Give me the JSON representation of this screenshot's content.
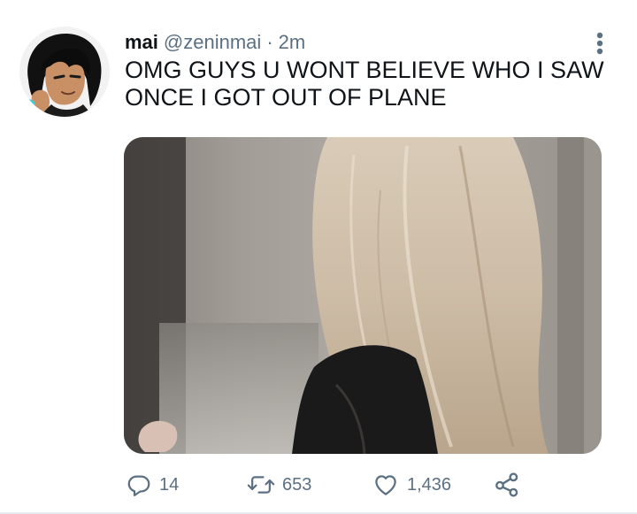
{
  "tweet": {
    "author": {
      "name": "mai",
      "handle": "@zeninmai",
      "separator": "·",
      "time": "2m"
    },
    "text_lines": [
      "OMG GUYS U WONT BELIEVE WHO I SAW",
      "ONCE I GOT OUT OF PLANE"
    ],
    "actions": {
      "replies": "14",
      "retweets": "653",
      "likes": "1,436"
    }
  },
  "icons": {
    "more": "more-vertical-icon",
    "reply": "reply-icon",
    "retweet": "retweet-icon",
    "like": "heart-icon",
    "share": "share-icon"
  },
  "colors": {
    "text": "#0f1419",
    "secondary": "#5b7083",
    "background": "#ffffff"
  }
}
